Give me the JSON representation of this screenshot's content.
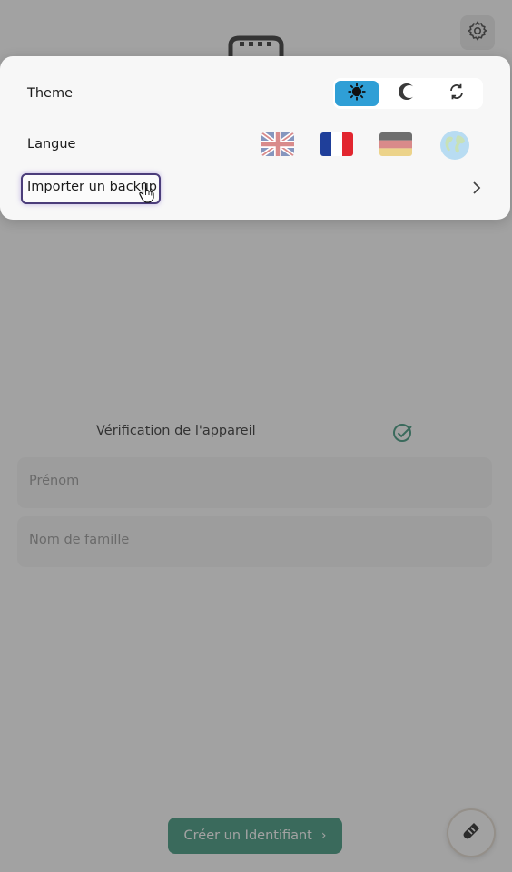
{
  "settings_sheet": {
    "theme_label": "Theme",
    "theme_options": [
      {
        "name": "light",
        "icon": "sun-icon",
        "selected": true
      },
      {
        "name": "dark",
        "icon": "moon-icon",
        "selected": false
      },
      {
        "name": "auto",
        "icon": "sync-icon",
        "selected": false
      }
    ],
    "language_label": "Langue",
    "languages": [
      {
        "code": "en",
        "icon": "uk-flag-icon"
      },
      {
        "code": "fr",
        "icon": "france-flag-icon"
      },
      {
        "code": "de",
        "icon": "germany-flag-icon"
      },
      {
        "code": "world",
        "icon": "globe-icon"
      }
    ],
    "import_label": "Importer un backup"
  },
  "form": {
    "verification_label": "Vérification de l'appareil",
    "firstname_placeholder": "Prénom",
    "lastname_placeholder": "Nom de famille",
    "create_button_label": "Créer un Identifiant",
    "create_button_chevron": "›"
  },
  "colors": {
    "theme_selected": "#2f9fd6",
    "create_button": "#2f8f73",
    "focus_ring": "#4b3d7a",
    "check": "#2f8f73"
  }
}
